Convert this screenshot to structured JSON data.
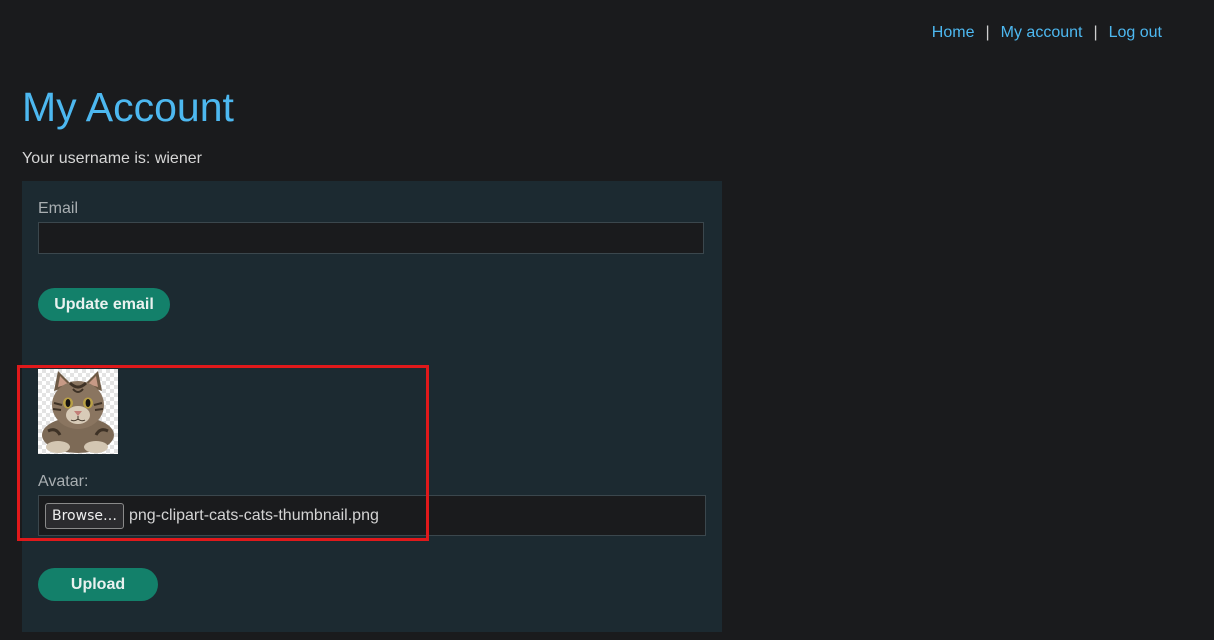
{
  "nav": {
    "home": "Home",
    "my_account": "My account",
    "log_out": "Log out",
    "separator": "|"
  },
  "page": {
    "title": "My Account",
    "username_line": "Your username is: wiener"
  },
  "email_form": {
    "label": "Email",
    "value": "",
    "button": "Update email"
  },
  "avatar_form": {
    "image_icon": "cat-avatar-image",
    "label": "Avatar:",
    "browse_button": "Browse…",
    "file_name": "png-clipart-cats-cats-thumbnail.png",
    "upload_button": "Upload"
  },
  "colors": {
    "link": "#4db8f0",
    "button": "#13806a",
    "panel": "#1c2a31",
    "background": "#1a1b1d",
    "highlight": "#e0191b"
  }
}
